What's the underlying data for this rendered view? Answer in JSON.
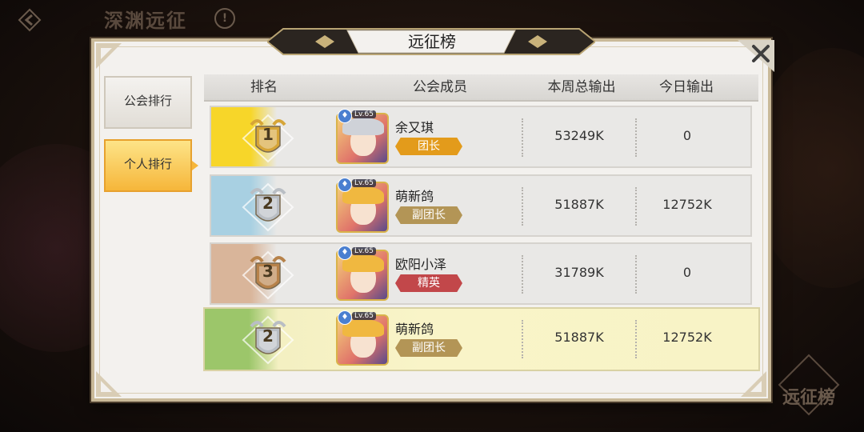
{
  "topbar": {
    "mode_title": "深渊远征",
    "info_label": "!"
  },
  "corner_badge": {
    "text": "远征榜"
  },
  "panel": {
    "title": "远征榜"
  },
  "tabs": [
    {
      "label": "公会排行",
      "selected": false
    },
    {
      "label": "个人排行",
      "selected": true
    }
  ],
  "table": {
    "headers": [
      "排名",
      "公会成员",
      "本周总输出",
      "今日输出"
    ],
    "rows": [
      {
        "rank": "1",
        "level": "Lv.65",
        "name": "余又琪",
        "role": "团长",
        "role_type": "leader",
        "weekly": "53249K",
        "today": "0",
        "accent": "#f7d629",
        "medal_color": "#d6a538"
      },
      {
        "rank": "2",
        "level": "Lv.65",
        "name": "萌新鸽",
        "role": "副团长",
        "role_type": "vice",
        "weekly": "51887K",
        "today": "12752K",
        "accent": "#a8d0e2",
        "medal_color": "#b9bec4"
      },
      {
        "rank": "3",
        "level": "Lv.65",
        "name": "欧阳小泽",
        "role": "精英",
        "role_type": "elite",
        "weekly": "31789K",
        "today": "0",
        "accent": "#d9b59a",
        "medal_color": "#b7824a"
      }
    ],
    "my_row": {
      "rank": "2",
      "level": "Lv.65",
      "name": "萌新鸽",
      "role": "副团长",
      "role_type": "vice",
      "weekly": "51887K",
      "today": "12752K",
      "accent": "#9cc66a",
      "medal_color": "#b9bec4"
    }
  }
}
